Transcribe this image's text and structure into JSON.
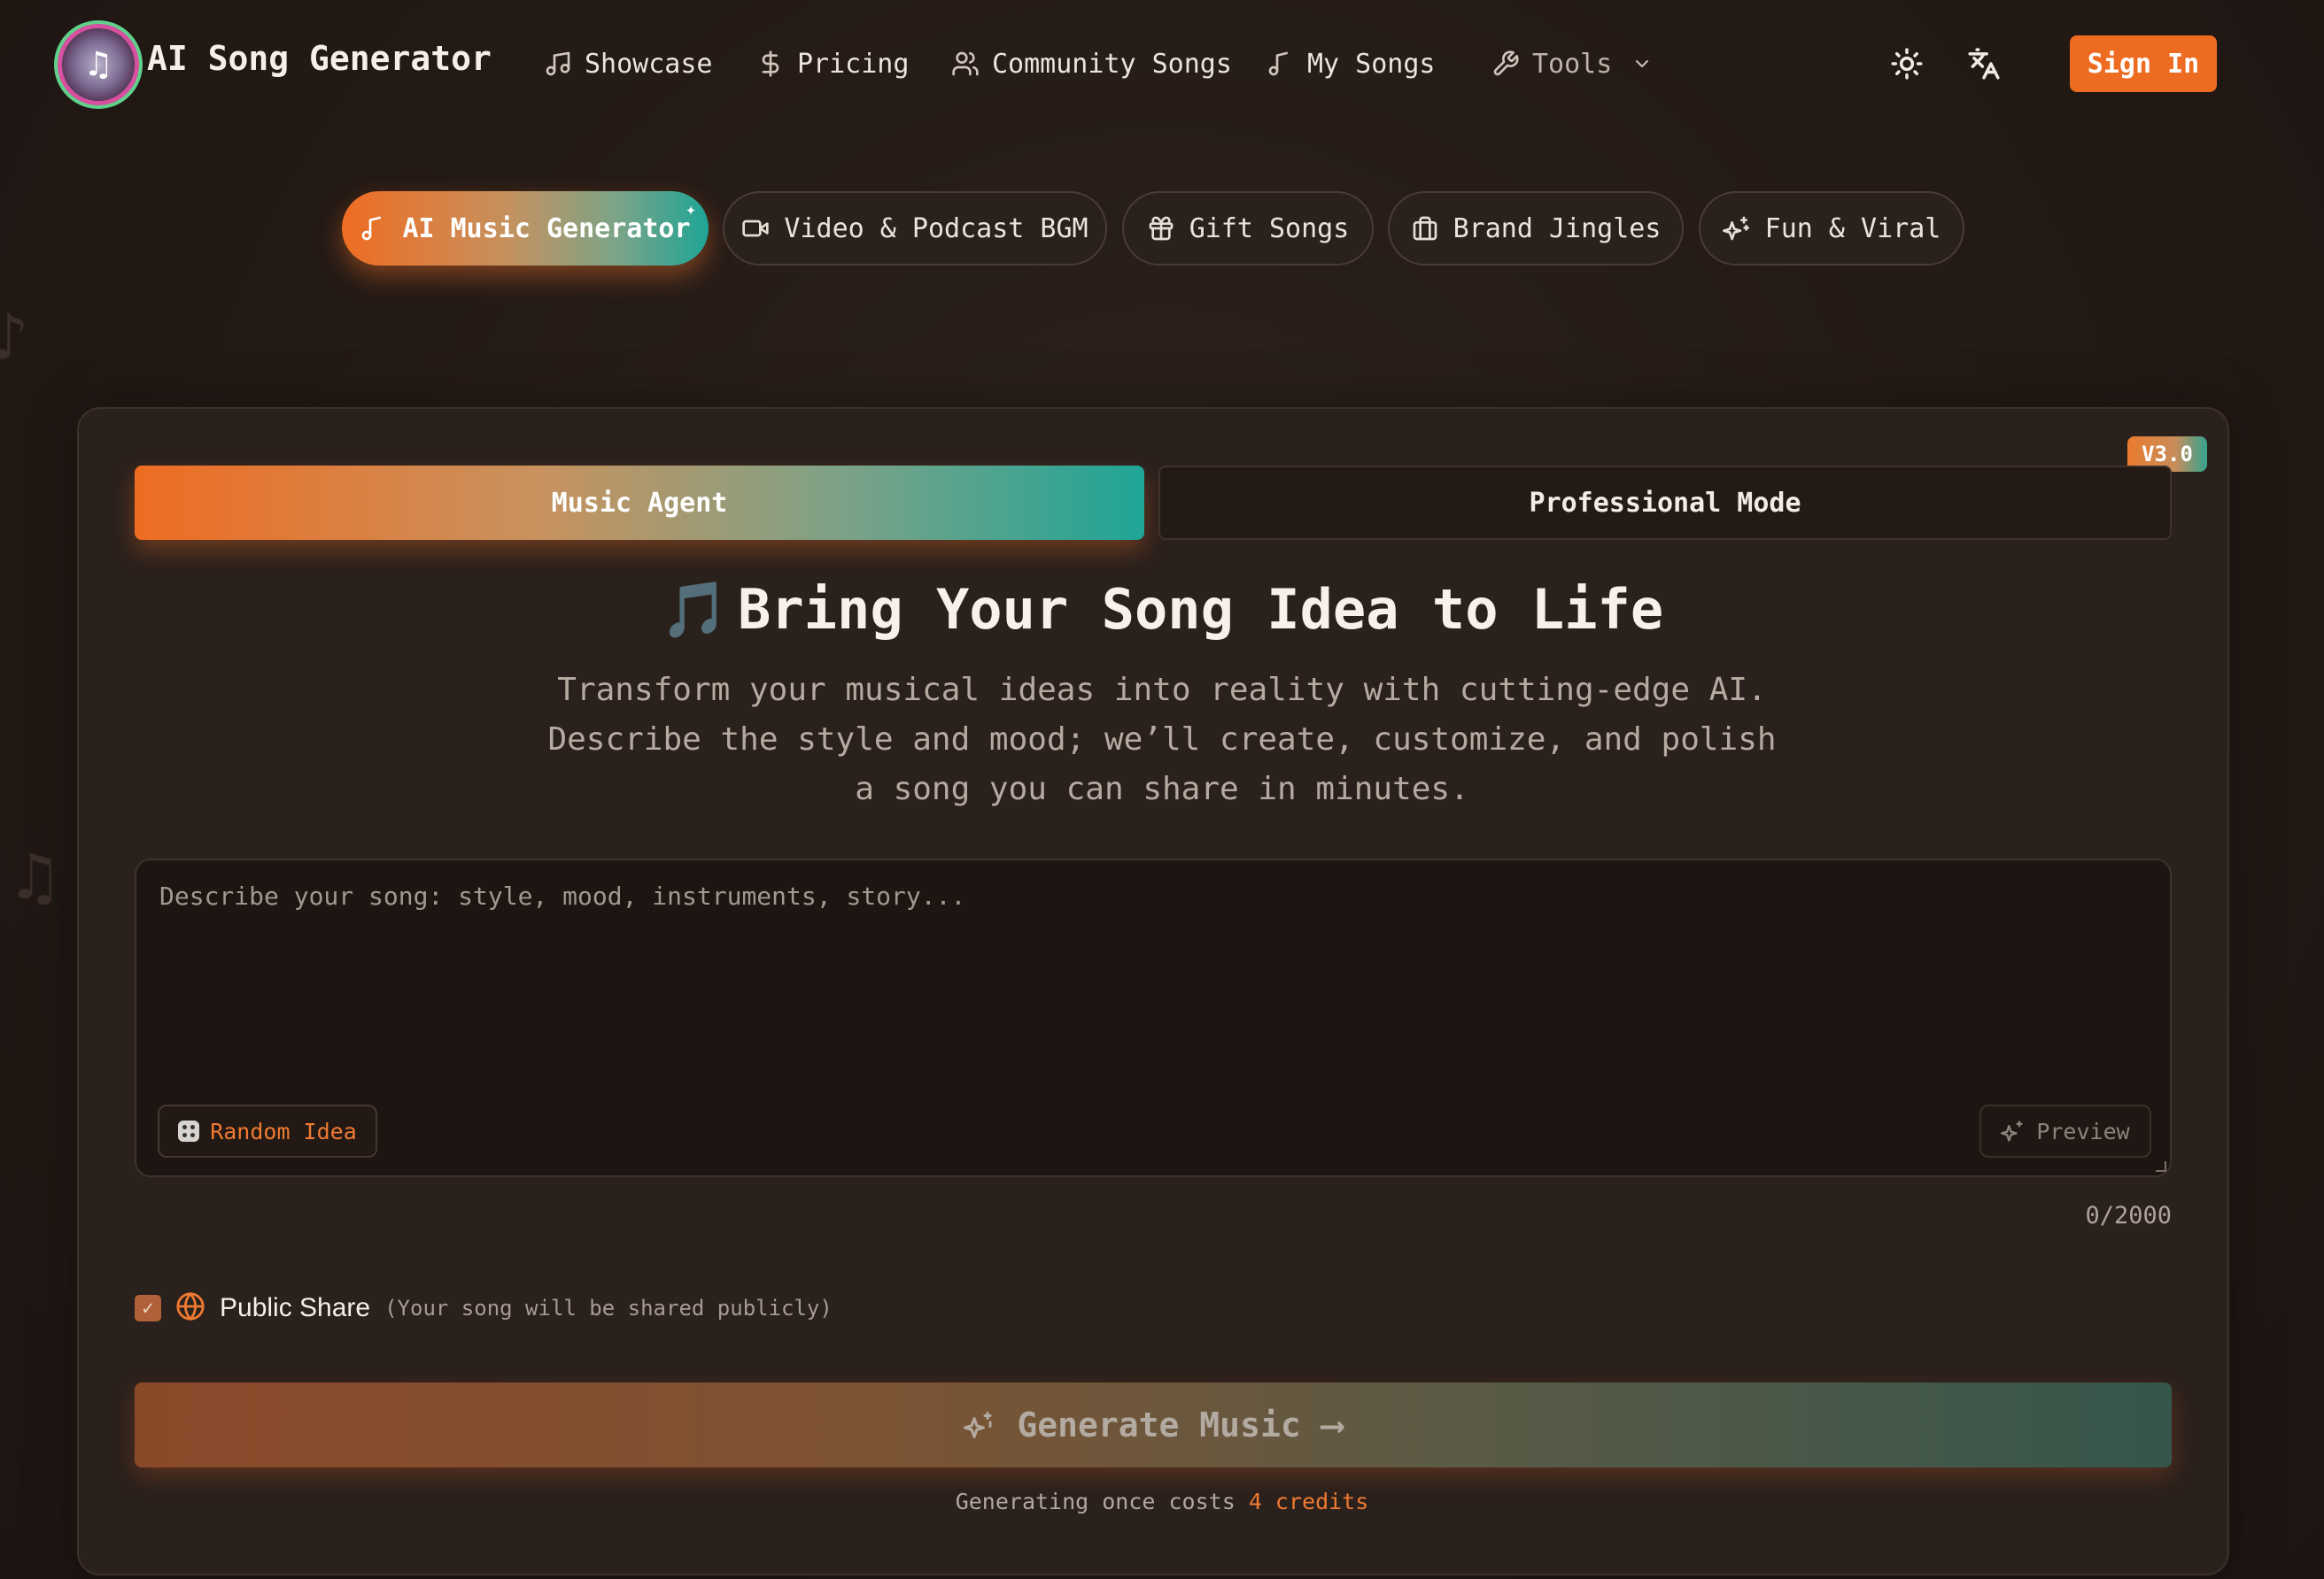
{
  "header": {
    "brand": "AI Song Generator",
    "nav": [
      {
        "label": "Showcase",
        "icon": "music-note-icon"
      },
      {
        "label": "Pricing",
        "icon": "dollar-icon"
      },
      {
        "label": "Community Songs",
        "icon": "users-icon"
      },
      {
        "label": "My Songs",
        "icon": "music-single-icon"
      },
      {
        "label": "Tools",
        "icon": "wrench-icon"
      }
    ],
    "sign_in": "Sign In"
  },
  "categories": [
    {
      "label": "AI Music Generator",
      "icon": "music-single-icon",
      "active": true
    },
    {
      "label": "Video & Podcast BGM",
      "icon": "video-icon",
      "active": false
    },
    {
      "label": "Gift Songs",
      "icon": "gift-icon",
      "active": false
    },
    {
      "label": "Brand Jingles",
      "icon": "briefcase-icon",
      "active": false
    },
    {
      "label": "Fun & Viral",
      "icon": "sparkles-icon",
      "active": false
    }
  ],
  "card": {
    "version": "V3.0",
    "tabs": {
      "active": "Music Agent",
      "inactive": "Professional Mode"
    },
    "title": "Bring Your Song Idea to Life",
    "title_emoji": "🎵",
    "subtitle": "Transform your musical ideas into reality with cutting-edge AI. Describe the style and mood; we’ll create, customize, and polish a song you can share in minutes.",
    "prompt": {
      "placeholder": "Describe your song: style, mood, instruments, story...",
      "value": "",
      "random_label": "Random Idea",
      "preview_label": "Preview",
      "char_count": "0/2000"
    },
    "share": {
      "checked": true,
      "label": "Public Share",
      "note": "(Your song will be shared publicly)"
    },
    "generate_label": "Generate Music",
    "cost_prefix": "Generating once costs",
    "cost_credits": "4 credits"
  },
  "colors": {
    "accent": "#ee6c22",
    "teal": "#1fa596",
    "background": "#241a16"
  }
}
